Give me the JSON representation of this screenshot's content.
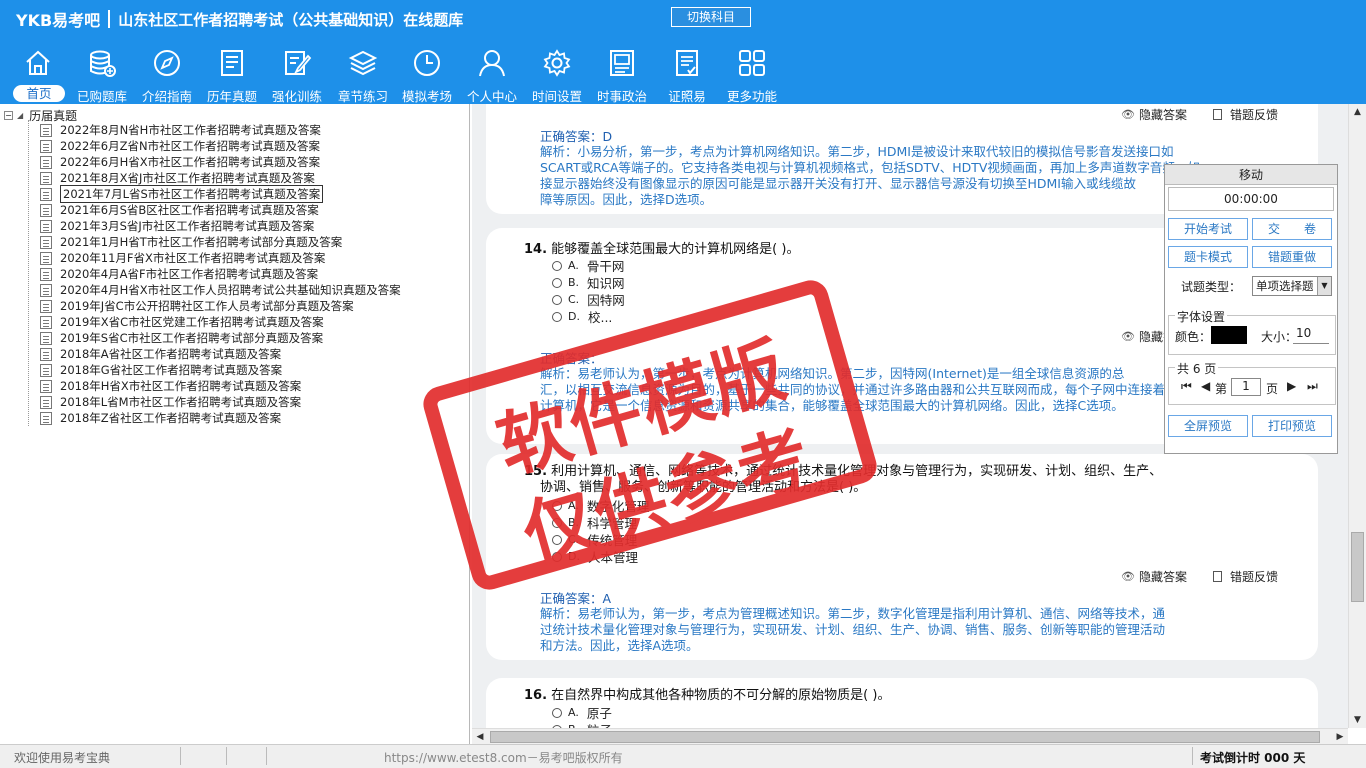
{
  "brand": {
    "logo": "YKB易考吧",
    "title": "山东社区工作者招聘考试（公共基础知识）在线题库"
  },
  "switch_subject": "切换科目",
  "toolbar": [
    {
      "label": "首页",
      "icon": "home-icon"
    },
    {
      "label": "已购题库",
      "icon": "database-icon"
    },
    {
      "label": "介绍指南",
      "icon": "compass-icon"
    },
    {
      "label": "历年真题",
      "icon": "document-list-icon"
    },
    {
      "label": "强化训练",
      "icon": "edit-icon"
    },
    {
      "label": "章节练习",
      "icon": "layers-icon"
    },
    {
      "label": "模拟考场",
      "icon": "clock-icon"
    },
    {
      "label": "个人中心",
      "icon": "user-icon"
    },
    {
      "label": "时间设置",
      "icon": "gear-icon"
    },
    {
      "label": "时事政治",
      "icon": "news-icon"
    },
    {
      "label": "证照易",
      "icon": "certificate-icon"
    },
    {
      "label": "更多功能",
      "icon": "grid-icon"
    }
  ],
  "tree": {
    "root_label": "历届真题",
    "items": [
      "2022年8月N省H市社区工作者招聘考试真题及答案",
      "2022年6月Z省N市社区工作者招聘考试真题及答案",
      "2022年6月H省X市社区工作者招聘考试真题及答案",
      "2021年8月X省J市社区工作者招聘考试真题及答案",
      "2021年7月L省S市社区工作者招聘考试真题及答案",
      "2021年6月S省B区社区工作者招聘考试真题及答案",
      "2021年3月S省J市社区工作者招聘考试真题及答案",
      "2021年1月H省T市社区工作者招聘考试部分真题及答案",
      "2020年11月F省X市社区工作者招聘考试真题及答案",
      "2020年4月A省F市社区工作者招聘考试真题及答案",
      "2020年4月H省X市社区工作人员招聘考试公共基础知识真题及答案",
      "2019年J省C市公开招聘社区工作人员考试部分真题及答案",
      "2019年X省C市社区党建工作者招聘考试真题及答案",
      "2019年S省C市社区工作者招聘考试部分真题及答案",
      "2018年A省社区工作者招聘考试真题及答案",
      "2018年G省社区工作者招聘考试真题及答案",
      "2018年H省X市社区工作者招聘考试真题及答案",
      "2018年L省M市社区工作者招聘考试真题及答案",
      "2018年Z省社区工作者招聘考试真题及答案"
    ],
    "selected_index": 4
  },
  "questions": {
    "hide_answer": "隐藏答案",
    "report_error": "错题反馈",
    "q13": {
      "answer": "正确答案：D",
      "explanation_l1": "解析：小易分析，第一步，考点为计算机网络知识。第二步，HDMI是被设计来取代较旧的模拟信号影音发送接口如",
      "explanation_l2": "SCART或RCA等端子的。它支持各类电视与计算机视频格式，包括SDTV、HDTV视频画面，再加上多声道数字音频。如",
      "explanation_l3": "接显示器始终没有图像显示的原因可能是显示器开关没有打开、显示器信号源没有切换至HDMI输入或线缆故",
      "explanation_l4": "障等原因。因此，选择D选项。"
    },
    "q14": {
      "num": "14.",
      "text": "能够覆盖全球范围最大的计算机网络是( )。",
      "options": [
        {
          "key": "A.",
          "text": "骨干网"
        },
        {
          "key": "B.",
          "text": "知识网"
        },
        {
          "key": "C.",
          "text": "因特网"
        },
        {
          "key": "D.",
          "text": "校..."
        }
      ],
      "answer": "正确答案：",
      "explanation_l1": "解析：易老师认为，第一步，考点为计算机网络知识。第二步，因特网(Internet)是一组全球信息资源的总",
      "explanation_l2": "汇，以相互交流信息资源为目的，基于一些共同的协议，并通过许多路由器和公共互联网而成，每个子网中连接着若干台",
      "explanation_l3": "计算机，它是一个信息资源和资源共享的集合，能够覆盖全球范围最大的计算机网络。因此，选择C选项。"
    },
    "q15": {
      "num": "15.",
      "text_l1": "利用计算机、通信、网络等技术，通过统计技术量化管理对象与管理行为，实现研发、计划、组织、生产、",
      "text_l2": "协调、销售、服务、创新等职能的管理活动和方法是( )。",
      "options": [
        {
          "key": "A.",
          "text": "数字化管理"
        },
        {
          "key": "B.",
          "text": "科学管理"
        },
        {
          "key": "C.",
          "text": "传统管理"
        },
        {
          "key": "D.",
          "text": "人本管理"
        }
      ],
      "answer": "正确答案：A",
      "explanation_l1": "解析：易老师认为，第一步，考点为管理概述知识。第二步，数字化管理是指利用计算机、通信、网络等技术，通",
      "explanation_l2": "过统计技术量化管理对象与管理行为，实现研发、计划、组织、生产、协调、销售、服务、创新等职能的管理活动",
      "explanation_l3": "和方法。因此，选择A选项。"
    },
    "q16": {
      "num": "16.",
      "text": "在自然界中构成其他各种物质的不可分解的原始物质是( )。",
      "options": [
        {
          "key": "A.",
          "text": "原子"
        },
        {
          "key": "B.",
          "text": "粒子"
        }
      ]
    }
  },
  "panel": {
    "title": "移动",
    "timer": "00:00:00",
    "start_exam": "开始考试",
    "submit": "交　　卷",
    "card_mode": "题卡模式",
    "redo_wrong": "错题重做",
    "type_label": "试题类型：",
    "type_value": "单项选择题",
    "font_group": "字体设置",
    "color_label": "颜色：",
    "size_label": "大小：",
    "size_value": "10",
    "pages_label": "共 6 页",
    "page_prefix": "第",
    "page_value": "1",
    "page_suffix": "页",
    "fullscreen": "全屏预览",
    "print_preview": "打印预览"
  },
  "watermark": {
    "line1": "软件模版",
    "line2": "仅供参考"
  },
  "status": {
    "welcome": "欢迎使用易考宝典",
    "copyright": "https://www.etest8.com－易考吧版权所有",
    "countdown": "考试倒计时 000 天"
  },
  "colors": {
    "header": "#1e90e9",
    "answer_text": "#2a78c4",
    "stamp": "#e22d2d"
  }
}
